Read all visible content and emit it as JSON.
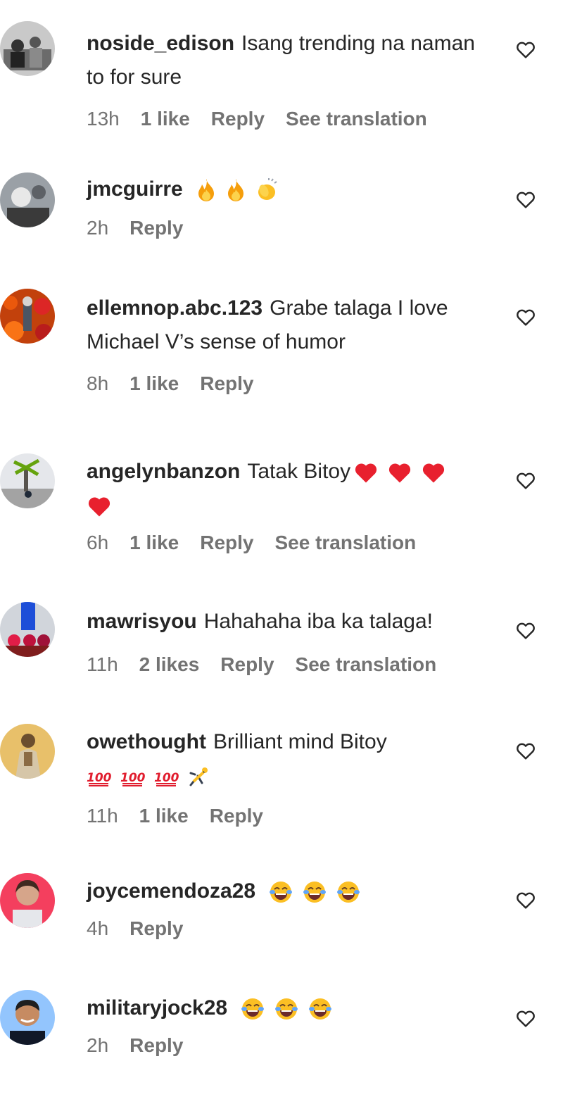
{
  "comments": [
    {
      "username": "noside_edison",
      "text": "Isang trending na naman to for sure",
      "time": "13h",
      "likes": "1 like",
      "reply": "Reply",
      "translate": "See translation"
    },
    {
      "username": "jmcguirre",
      "text": "",
      "emoji": [
        "fire",
        "fire",
        "clap"
      ],
      "time": "2h",
      "likes": "",
      "reply": "Reply",
      "translate": ""
    },
    {
      "username": "ellemnop.abc.123",
      "text": "Grabe talaga I love Michael V’s sense of humor",
      "time": "8h",
      "likes": "1 like",
      "reply": "Reply",
      "translate": ""
    },
    {
      "username": "angelynbanzon",
      "text": "Tatak Bitoy",
      "emoji": [
        "red-heart",
        "red-heart",
        "red-heart",
        "red-heart"
      ],
      "time": "6h",
      "likes": "1 like",
      "reply": "Reply",
      "translate": "See translation"
    },
    {
      "username": "mawrisyou",
      "text": "Hahahaha iba ka talaga!",
      "time": "11h",
      "likes": "2 likes",
      "reply": "Reply",
      "translate": "See translation"
    },
    {
      "username": "owethought",
      "text": "Brilliant mind Bitoy",
      "emoji": [
        "hundred",
        "hundred",
        "hundred",
        "cartwheel"
      ],
      "time": "11h",
      "likes": "1 like",
      "reply": "Reply",
      "translate": ""
    },
    {
      "username": "joycemendoza28",
      "text": "",
      "emoji": [
        "joy",
        "joy",
        "joy"
      ],
      "time": "4h",
      "likes": "",
      "reply": "Reply",
      "translate": ""
    },
    {
      "username": "militaryjock28",
      "text": "",
      "emoji": [
        "joy",
        "joy",
        "joy"
      ],
      "time": "2h",
      "likes": "",
      "reply": "Reply",
      "translate": ""
    }
  ],
  "icons": {
    "like": "heart-outline-icon"
  },
  "colors": {
    "text": "#262626",
    "meta": "#737373",
    "heart-red": "#e8202e",
    "fire": "#f59e0b"
  }
}
